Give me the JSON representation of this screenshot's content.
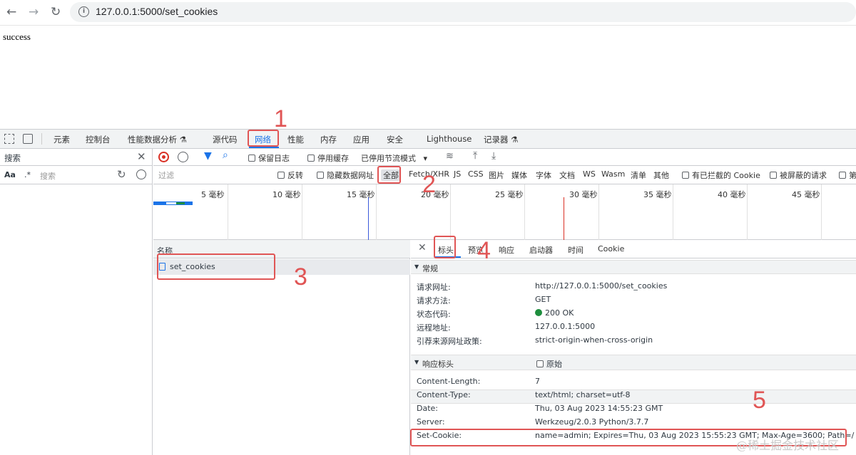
{
  "browser": {
    "url": "127.0.0.1:5000/set_cookies",
    "back_icon": "back-arrow-icon",
    "forward_icon": "forward-arrow-icon",
    "reload_icon": "reload-icon"
  },
  "page": {
    "body_text": "success"
  },
  "devtools": {
    "tabs": [
      "元素",
      "控制台",
      "性能数据分析 ⚗",
      "源代码",
      "网络",
      "性能",
      "内存",
      "应用",
      "安全",
      "Lighthouse",
      "记录器 ⚗"
    ],
    "active_tab": "网络",
    "left": {
      "search_title": "搜索",
      "aa": "Aa",
      "dot": ".*",
      "search_placeholder": "搜索"
    },
    "toolbar": {
      "preserve_log": "保留日志",
      "disable_cache": "停用缓存",
      "throttling": "已停用节流模式"
    },
    "filter_bar": {
      "filter_placeholder": "过滤",
      "invert": "反转",
      "hide_data_urls": "隐藏数据网址",
      "types": [
        "全部",
        "Fetch/XHR",
        "JS",
        "CSS",
        "图片",
        "媒体",
        "字体",
        "文档",
        "WS",
        "Wasm",
        "清单",
        "其他"
      ],
      "blocked_cookies": "有已拦截的 Cookie",
      "blocked_requests": "被屏蔽的请求",
      "third_party": "第"
    },
    "timeline_labels": [
      "5 毫秒",
      "10 毫秒",
      "15 毫秒",
      "20 毫秒",
      "25 毫秒",
      "30 毫秒",
      "35 毫秒",
      "40 毫秒",
      "45 毫秒"
    ],
    "name_column": {
      "header": "名称",
      "rows": [
        "set_cookies"
      ]
    },
    "detail_tabs": [
      "标头",
      "预览",
      "响应",
      "启动器",
      "时间",
      "Cookie"
    ],
    "general": {
      "title": "常规",
      "rows": [
        {
          "k": "请求网址:",
          "v": "http://127.0.0.1:5000/set_cookies"
        },
        {
          "k": "请求方法:",
          "v": "GET"
        },
        {
          "k": "状态代码:",
          "v": "200 OK"
        },
        {
          "k": "远程地址:",
          "v": "127.0.0.1:5000"
        },
        {
          "k": "引荐来源网址政策:",
          "v": "strict-origin-when-cross-origin"
        }
      ]
    },
    "response_headers": {
      "title": "响应标头",
      "raw_label": "原始",
      "rows": [
        {
          "k": "Content-Length:",
          "v": "7"
        },
        {
          "k": "Content-Type:",
          "v": "text/html; charset=utf-8"
        },
        {
          "k": "Date:",
          "v": "Thu, 03 Aug 2023 14:55:23 GMT"
        },
        {
          "k": "Server:",
          "v": "Werkzeug/2.0.3 Python/3.7.7"
        },
        {
          "k": "Set-Cookie:",
          "v": "name=admin; Expires=Thu, 03 Aug 2023 15:55:23 GMT; Max-Age=3600; Path=/"
        }
      ]
    }
  },
  "annotations": [
    "1",
    "2",
    "3",
    "4",
    "5"
  ],
  "watermark": "@稀土掘金技术社区",
  "colors": {
    "accent": "#1a73e8",
    "annotation": "#e05555",
    "status_ok": "#1e8e3e"
  }
}
